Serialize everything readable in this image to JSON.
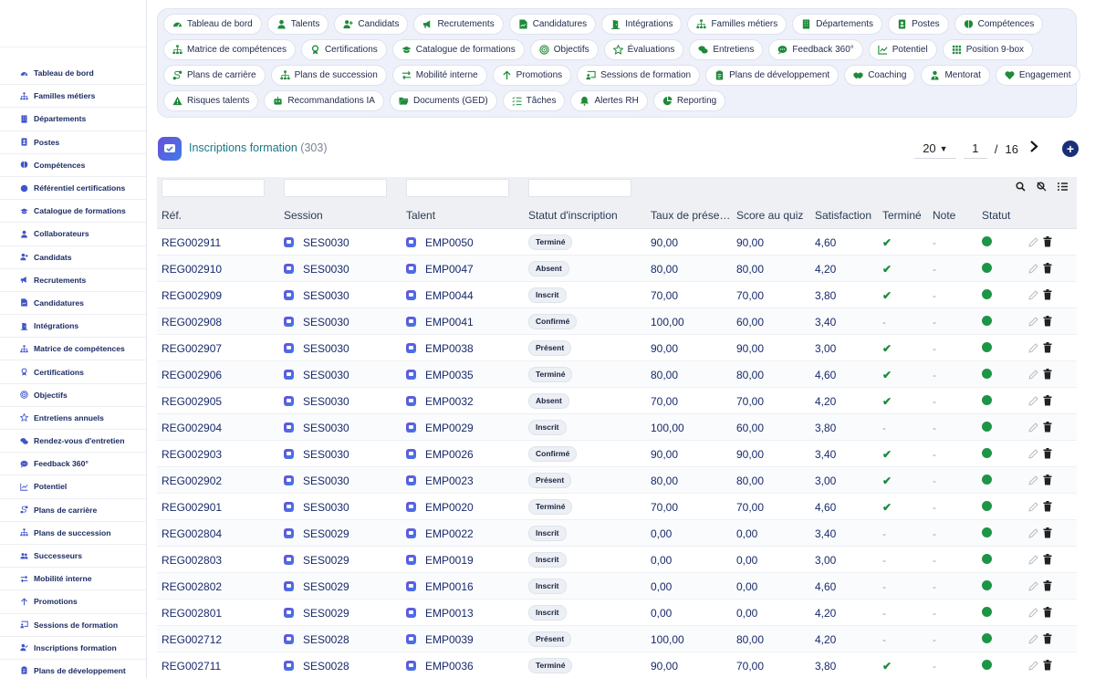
{
  "sidebar": {
    "items": [
      {
        "label": "Tableau de bord",
        "icon": "dashboard-icon"
      },
      {
        "label": "Familles métiers",
        "icon": "sitemap-icon"
      },
      {
        "label": "Départements",
        "icon": "building-icon"
      },
      {
        "label": "Postes",
        "icon": "id-badge-icon"
      },
      {
        "label": "Compétences",
        "icon": "brain-icon"
      },
      {
        "label": "Référentiel certifications",
        "icon": "certificate-icon"
      },
      {
        "label": "Catalogue de formations",
        "icon": "graduation-cap-icon"
      },
      {
        "label": "Collaborateurs",
        "icon": "user-icon"
      },
      {
        "label": "Candidats",
        "icon": "user-plus-icon"
      },
      {
        "label": "Recrutements",
        "icon": "megaphone-icon"
      },
      {
        "label": "Candidatures",
        "icon": "file-signature-icon"
      },
      {
        "label": "Intégrations",
        "icon": "door-open-icon"
      },
      {
        "label": "Matrice de compétences",
        "icon": "sitemap-icon"
      },
      {
        "label": "Certifications",
        "icon": "award-icon"
      },
      {
        "label": "Objectifs",
        "icon": "target-icon"
      },
      {
        "label": "Entretiens annuels",
        "icon": "star-icon"
      },
      {
        "label": "Rendez-vous d'entretien",
        "icon": "comments-icon"
      },
      {
        "label": "Feedback 360°",
        "icon": "comment-dots-icon"
      },
      {
        "label": "Potentiel",
        "icon": "chart-line-icon"
      },
      {
        "label": "Plans de carrière",
        "icon": "route-icon"
      },
      {
        "label": "Plans de succession",
        "icon": "sitemap-icon"
      },
      {
        "label": "Successeurs",
        "icon": "users-icon"
      },
      {
        "label": "Mobilité interne",
        "icon": "exchange-icon"
      },
      {
        "label": "Promotions",
        "icon": "arrow-up-icon"
      },
      {
        "label": "Sessions de formation",
        "icon": "chalkboard-icon"
      },
      {
        "label": "Inscriptions formation",
        "icon": "user-check-icon"
      },
      {
        "label": "Plans de développement",
        "icon": "clipboard-icon"
      }
    ]
  },
  "toolbar": {
    "rows": [
      [
        {
          "label": "Tableau de bord",
          "icon": "dashboard-icon"
        },
        {
          "label": "Talents",
          "icon": "user-icon"
        },
        {
          "label": "Candidats",
          "icon": "user-plus-icon"
        },
        {
          "label": "Recrutements",
          "icon": "megaphone-icon"
        },
        {
          "label": "Candidatures",
          "icon": "file-signature-icon"
        },
        {
          "label": "Intégrations",
          "icon": "door-open-icon"
        },
        {
          "label": "Familles métiers",
          "icon": "sitemap-icon"
        },
        {
          "label": "Départements",
          "icon": "building-icon"
        },
        {
          "label": "Postes",
          "icon": "id-badge-icon"
        },
        {
          "label": "Compétences",
          "icon": "brain-icon"
        }
      ],
      [
        {
          "label": "Matrice de compétences",
          "icon": "sitemap-icon"
        },
        {
          "label": "Certifications",
          "icon": "award-icon"
        },
        {
          "label": "Catalogue de formations",
          "icon": "graduation-cap-icon"
        },
        {
          "label": "Objectifs",
          "icon": "target-icon"
        },
        {
          "label": "Évaluations",
          "icon": "star-icon"
        },
        {
          "label": "Entretiens",
          "icon": "comments-icon"
        },
        {
          "label": "Feedback 360°",
          "icon": "comment-dots-icon"
        },
        {
          "label": "Potentiel",
          "icon": "chart-line-icon"
        },
        {
          "label": "Position 9-box",
          "icon": "grid-icon"
        }
      ],
      [
        {
          "label": "Plans de carrière",
          "icon": "route-icon"
        },
        {
          "label": "Plans de succession",
          "icon": "sitemap-icon"
        },
        {
          "label": "Mobilité interne",
          "icon": "exchange-icon"
        },
        {
          "label": "Promotions",
          "icon": "arrow-up-icon"
        },
        {
          "label": "Sessions de formation",
          "icon": "chalkboard-icon"
        },
        {
          "label": "Plans de développement",
          "icon": "clipboard-icon"
        },
        {
          "label": "Coaching",
          "icon": "handshake-icon"
        },
        {
          "label": "Mentorat",
          "icon": "user-tie-icon"
        },
        {
          "label": "Engagement",
          "icon": "heart-icon"
        }
      ],
      [
        {
          "label": "Risques talents",
          "icon": "warning-icon"
        },
        {
          "label": "Recommandations IA",
          "icon": "robot-icon"
        },
        {
          "label": "Documents (GED)",
          "icon": "folder-open-icon"
        },
        {
          "label": "Tâches",
          "icon": "list-check-icon"
        },
        {
          "label": "Alertes RH",
          "icon": "bell-icon"
        },
        {
          "label": "Reporting",
          "icon": "pie-chart-icon"
        }
      ]
    ]
  },
  "header": {
    "title": "Inscriptions formation",
    "count": "(303)",
    "per_page": "20",
    "page": "1",
    "slash": "/",
    "total_pages": "16",
    "next": "›",
    "add": "+"
  },
  "table": {
    "columns": [
      "Réf.",
      "Session",
      "Talent",
      "Statut d'inscription",
      "Taux de prése…",
      "Score au quiz",
      "Satisfaction",
      "Terminé",
      "Note",
      "Statut"
    ],
    "rows": [
      {
        "ref": "REG002911",
        "session": "SES0030",
        "talent": "EMP0050",
        "statut": "Terminé",
        "taux": "90,00",
        "score": "90,00",
        "satisfaction": "4,60",
        "termine": true,
        "note": "-"
      },
      {
        "ref": "REG002910",
        "session": "SES0030",
        "talent": "EMP0047",
        "statut": "Absent",
        "taux": "80,00",
        "score": "80,00",
        "satisfaction": "4,20",
        "termine": true,
        "note": "-"
      },
      {
        "ref": "REG002909",
        "session": "SES0030",
        "talent": "EMP0044",
        "statut": "Inscrit",
        "taux": "70,00",
        "score": "70,00",
        "satisfaction": "3,80",
        "termine": true,
        "note": "-"
      },
      {
        "ref": "REG002908",
        "session": "SES0030",
        "talent": "EMP0041",
        "statut": "Confirmé",
        "taux": "100,00",
        "score": "60,00",
        "satisfaction": "3,40",
        "termine": false,
        "note": "-"
      },
      {
        "ref": "REG002907",
        "session": "SES0030",
        "talent": "EMP0038",
        "statut": "Présent",
        "taux": "90,00",
        "score": "90,00",
        "satisfaction": "3,00",
        "termine": true,
        "note": "-"
      },
      {
        "ref": "REG002906",
        "session": "SES0030",
        "talent": "EMP0035",
        "statut": "Terminé",
        "taux": "80,00",
        "score": "80,00",
        "satisfaction": "4,60",
        "termine": true,
        "note": "-"
      },
      {
        "ref": "REG002905",
        "session": "SES0030",
        "talent": "EMP0032",
        "statut": "Absent",
        "taux": "70,00",
        "score": "70,00",
        "satisfaction": "4,20",
        "termine": true,
        "note": "-"
      },
      {
        "ref": "REG002904",
        "session": "SES0030",
        "talent": "EMP0029",
        "statut": "Inscrit",
        "taux": "100,00",
        "score": "60,00",
        "satisfaction": "3,80",
        "termine": false,
        "note": "-"
      },
      {
        "ref": "REG002903",
        "session": "SES0030",
        "talent": "EMP0026",
        "statut": "Confirmé",
        "taux": "90,00",
        "score": "90,00",
        "satisfaction": "3,40",
        "termine": true,
        "note": "-"
      },
      {
        "ref": "REG002902",
        "session": "SES0030",
        "talent": "EMP0023",
        "statut": "Présent",
        "taux": "80,00",
        "score": "80,00",
        "satisfaction": "3,00",
        "termine": true,
        "note": "-"
      },
      {
        "ref": "REG002901",
        "session": "SES0030",
        "talent": "EMP0020",
        "statut": "Terminé",
        "taux": "70,00",
        "score": "70,00",
        "satisfaction": "4,60",
        "termine": true,
        "note": "-"
      },
      {
        "ref": "REG002804",
        "session": "SES0029",
        "talent": "EMP0022",
        "statut": "Inscrit",
        "taux": "0,00",
        "score": "0,00",
        "satisfaction": "3,40",
        "termine": false,
        "note": "-"
      },
      {
        "ref": "REG002803",
        "session": "SES0029",
        "talent": "EMP0019",
        "statut": "Inscrit",
        "taux": "0,00",
        "score": "0,00",
        "satisfaction": "3,00",
        "termine": false,
        "note": "-"
      },
      {
        "ref": "REG002802",
        "session": "SES0029",
        "talent": "EMP0016",
        "statut": "Inscrit",
        "taux": "0,00",
        "score": "0,00",
        "satisfaction": "4,60",
        "termine": false,
        "note": "-"
      },
      {
        "ref": "REG002801",
        "session": "SES0029",
        "talent": "EMP0013",
        "statut": "Inscrit",
        "taux": "0,00",
        "score": "0,00",
        "satisfaction": "4,20",
        "termine": false,
        "note": "-"
      },
      {
        "ref": "REG002712",
        "session": "SES0028",
        "talent": "EMP0039",
        "statut": "Présent",
        "taux": "100,00",
        "score": "80,00",
        "satisfaction": "4,20",
        "termine": false,
        "note": "-"
      },
      {
        "ref": "REG002711",
        "session": "SES0028",
        "talent": "EMP0036",
        "statut": "Terminé",
        "taux": "90,00",
        "score": "70,00",
        "satisfaction": "3,80",
        "termine": true,
        "note": "-"
      }
    ],
    "dash": "-",
    "check": "✔"
  },
  "colors": {
    "accent": "#167a86",
    "status_active": "#1e9447",
    "sidebar_text": "#1b2b63",
    "link": "#182a6b"
  }
}
